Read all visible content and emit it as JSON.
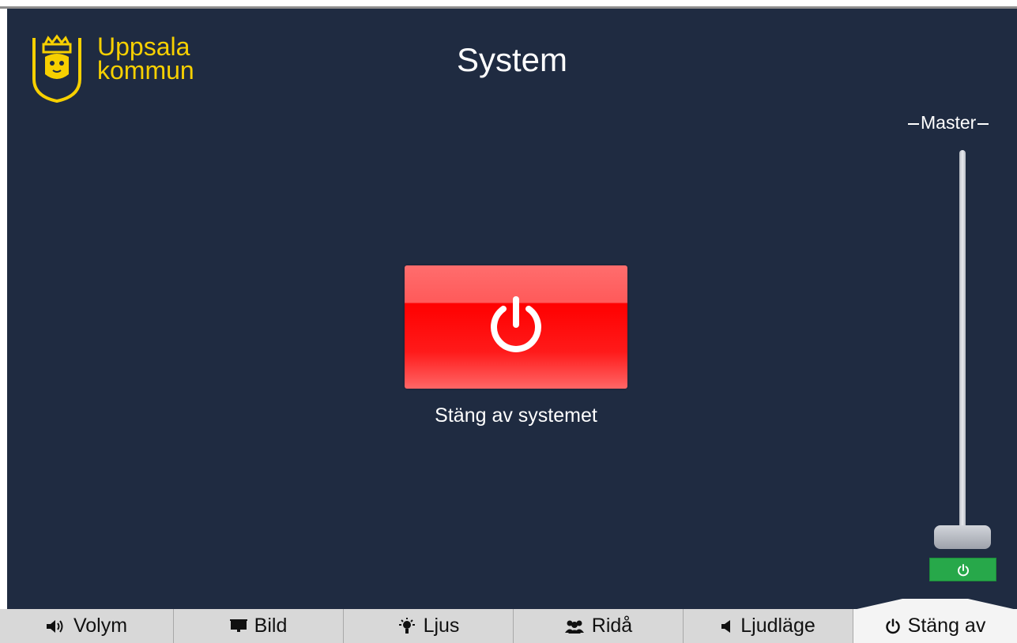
{
  "header": {
    "logo_line1": "Uppsala",
    "logo_line2": "kommun",
    "title": "System"
  },
  "main": {
    "power_button_icon": "power-icon",
    "power_caption": "Stäng av systemet"
  },
  "volume": {
    "label": "Master",
    "level": 0.0,
    "mute_icon": "power-icon"
  },
  "tabs": [
    {
      "label": "Volym",
      "icon": "speaker-icon",
      "active": false
    },
    {
      "label": "Bild",
      "icon": "projector-screen-icon",
      "active": false
    },
    {
      "label": "Ljus",
      "icon": "lightbulb-icon",
      "active": false
    },
    {
      "label": "Ridå",
      "icon": "people-icon",
      "active": false
    },
    {
      "label": "Ljudläge",
      "icon": "speaker-small-icon",
      "active": false
    },
    {
      "label": "Stäng av",
      "icon": "power-icon",
      "active": true
    }
  ],
  "colors": {
    "background": "#1f2b41",
    "brand_yellow": "#f7d000",
    "power_red": "#ff0000",
    "mute_green": "#27a84a"
  }
}
